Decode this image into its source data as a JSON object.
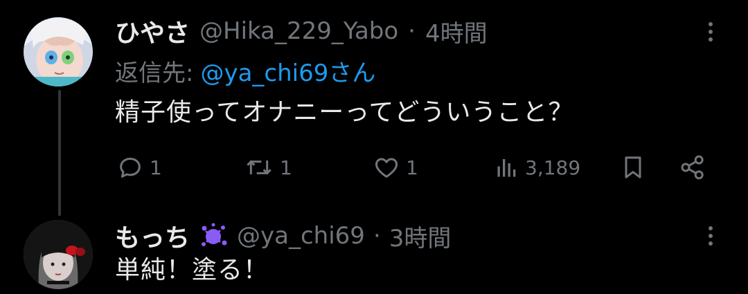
{
  "tweet": {
    "display_name": "ひやさ",
    "handle": "@Hika_229_Yabo",
    "separator": "·",
    "time": "4時間",
    "reply_to_label": "返信先:",
    "reply_to_handle": "@ya_chi69",
    "reply_to_suffix": "さん",
    "text": "精子使ってオナニーってどういうこと？",
    "actions": {
      "replies": "1",
      "retweets": "1",
      "likes": "1",
      "views": "3,189"
    }
  },
  "reply": {
    "display_name": "もっち",
    "badge_icon": "splat-emoji",
    "handle": "@ya_chi69",
    "separator": "·",
    "time": "3時間",
    "text": "単純！塗る！"
  },
  "colors": {
    "background": "#000000",
    "primary_text": "#e7e9ea",
    "secondary_text": "#71767b",
    "link": "#1d9bf0",
    "thread_line": "#333639",
    "splat": "#8a5cf6"
  }
}
